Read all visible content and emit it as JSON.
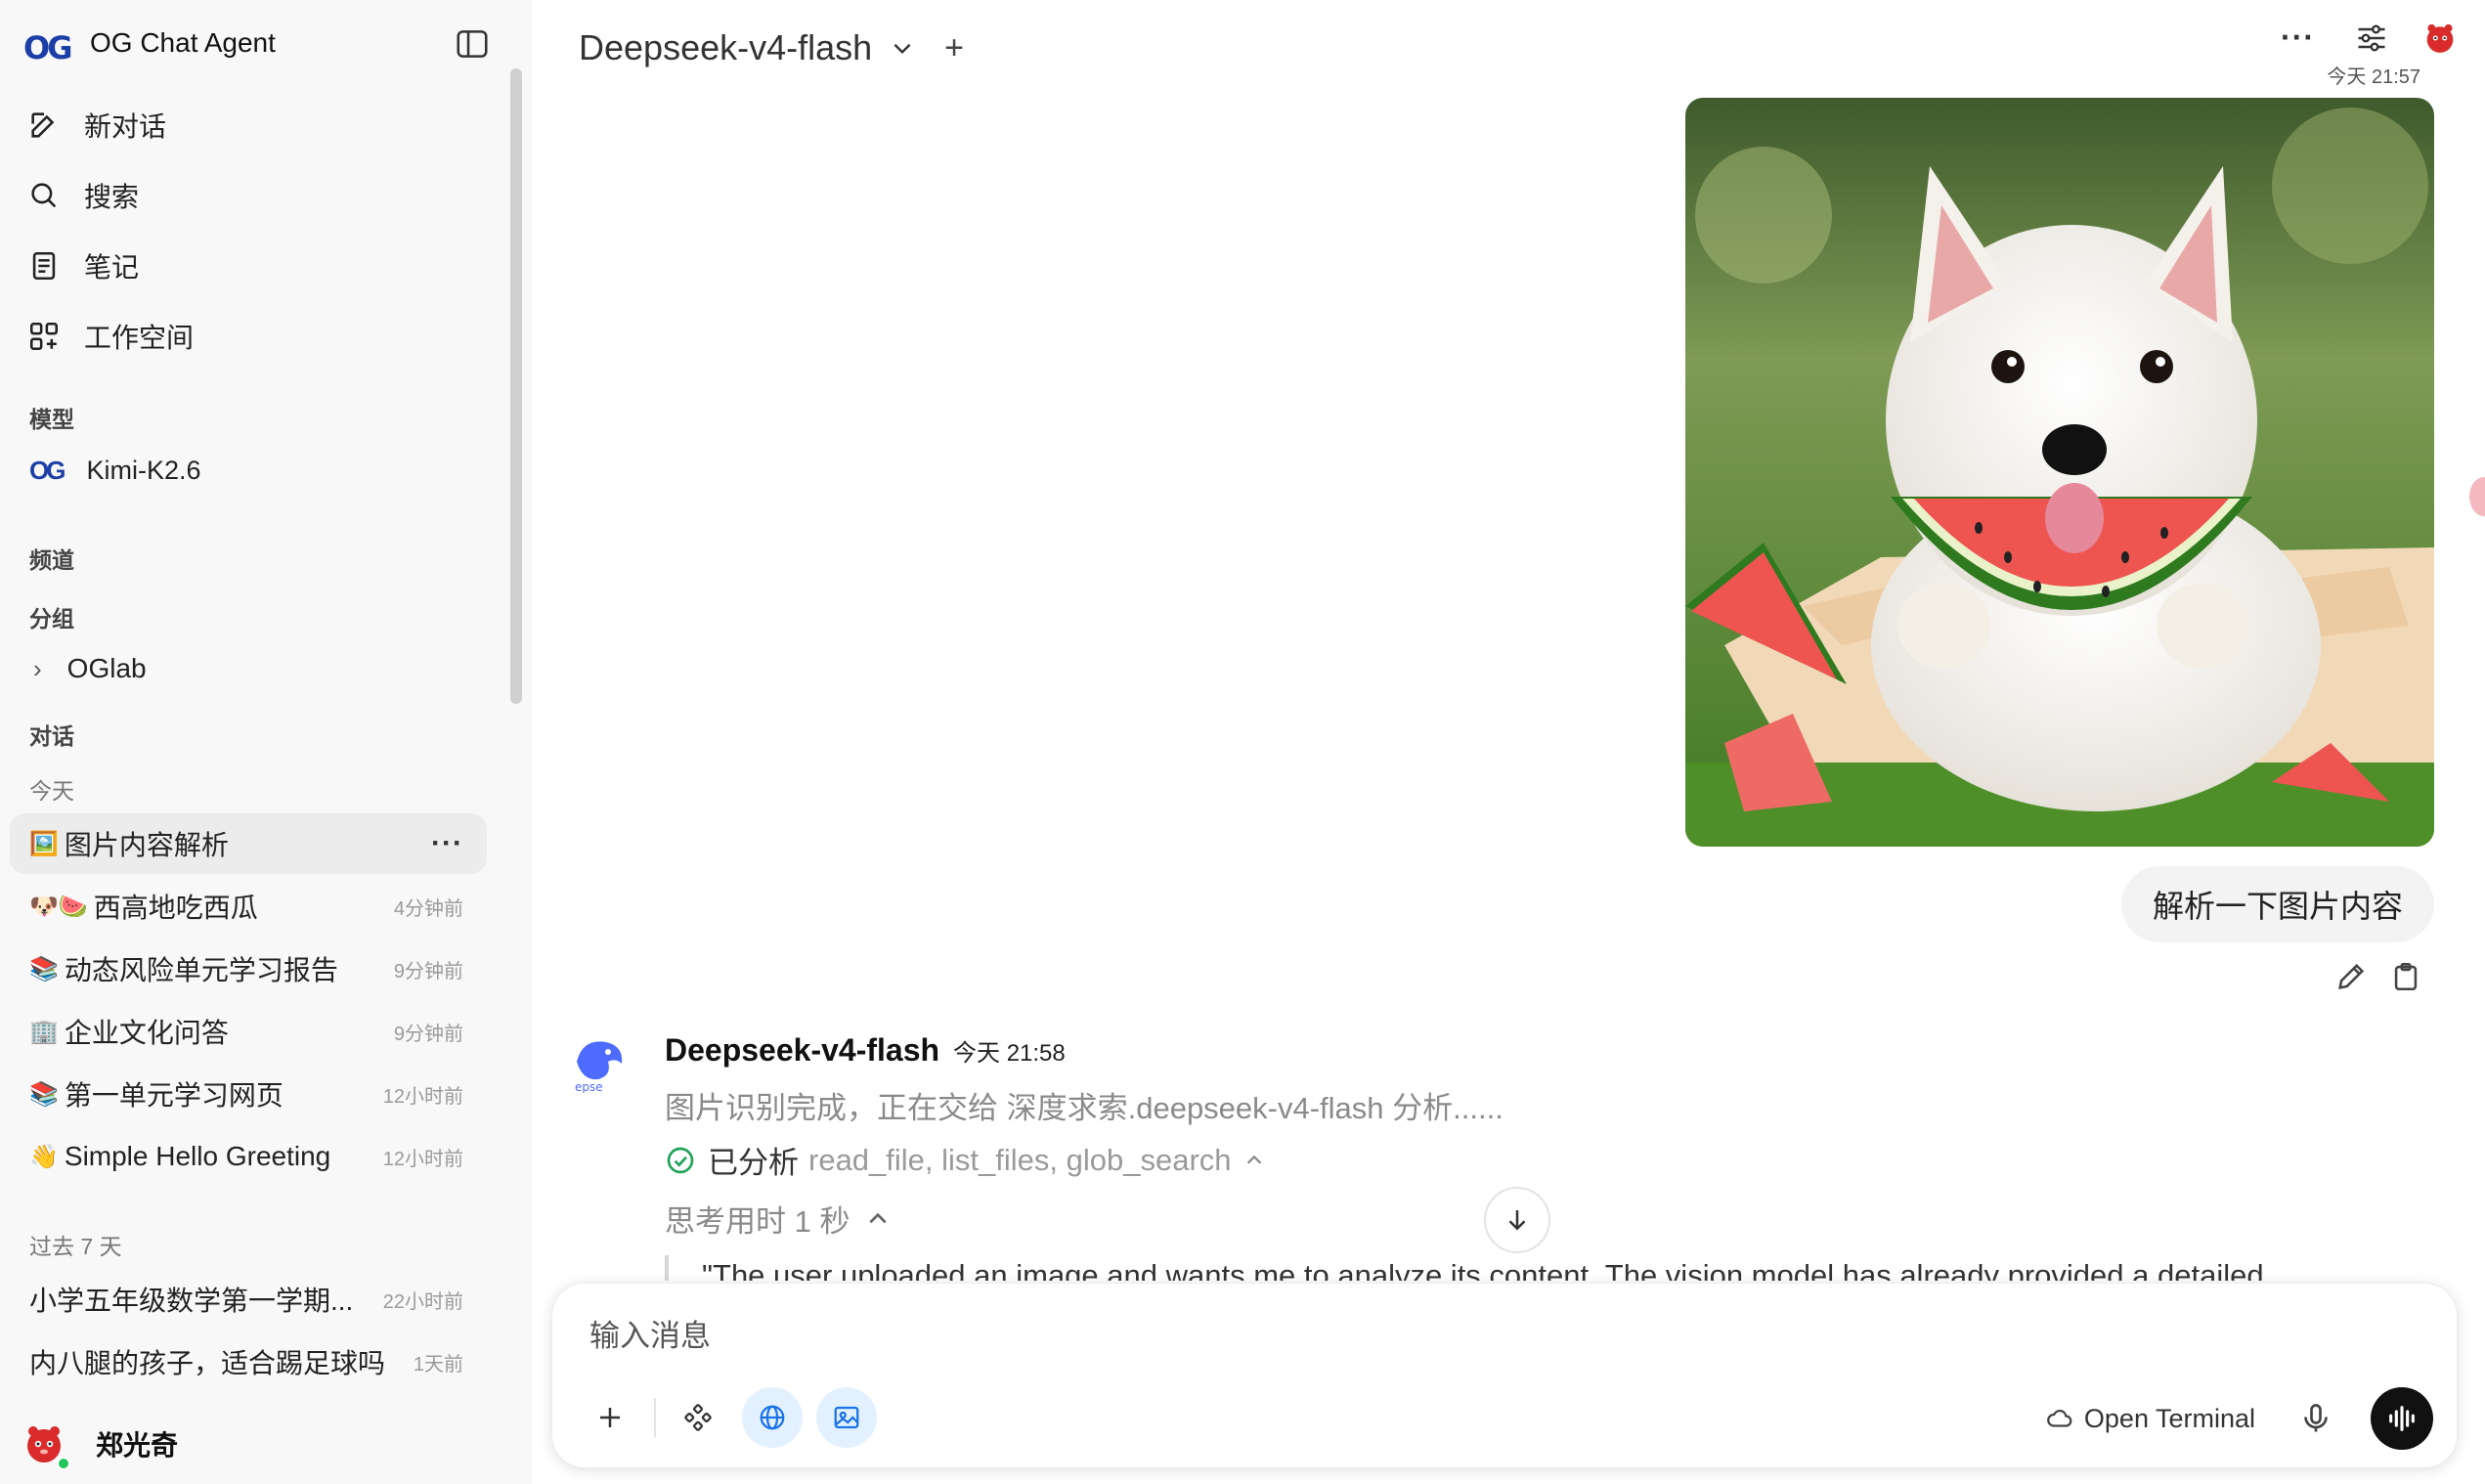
{
  "app": {
    "title": "OG Chat Agent",
    "logo_text": "OG"
  },
  "nav": {
    "new_chat": "新对话",
    "search": "搜索",
    "notes": "笔记",
    "workspace": "工作空间"
  },
  "sections": {
    "models": "模型",
    "channels": "频道",
    "groups": "分组",
    "chats": "对话",
    "today": "今天",
    "last7": "过去 7 天"
  },
  "models": [
    {
      "logo": "OG",
      "name": "Kimi-K2.6"
    }
  ],
  "groups": [
    {
      "name": "OGlab"
    }
  ],
  "conversations_today": [
    {
      "emoji": "🖼️",
      "title": "图片内容解析",
      "time": "",
      "active": true
    },
    {
      "emoji": "🐶🍉",
      "title": "西高地吃西瓜",
      "time": "4分钟前"
    },
    {
      "emoji": "📚",
      "title": "动态风险单元学习报告",
      "time": "9分钟前"
    },
    {
      "emoji": "🏢",
      "title": "企业文化问答",
      "time": "9分钟前"
    },
    {
      "emoji": "📚",
      "title": "第一单元学习网页",
      "time": "12小时前"
    },
    {
      "emoji": "👋",
      "title": "Simple Hello Greeting",
      "time": "12小时前"
    }
  ],
  "conversations_last7": [
    {
      "title": "小学五年级数学第一学期...",
      "time": "22小时前"
    },
    {
      "title": "内八腿的孩子，适合踢足球吗",
      "time": "1天前"
    }
  ],
  "user": {
    "name": "郑光奇"
  },
  "header": {
    "model_name": "Deepseek-v4-flash",
    "add_label": "+",
    "more_label": "···"
  },
  "user_message": {
    "time": "今天 21:57",
    "text": "解析一下图片内容",
    "image_alt": "west highland terrier eating watermelon"
  },
  "assistant_message": {
    "name": "Deepseek-v4-flash",
    "time": "今天 21:58",
    "status": "图片识别完成，正在交给 深度求索.deepseek-v4-flash 分析......",
    "tools_done_label": "已分析",
    "tools_list": "read_file, list_files, glob_search",
    "thinking_label": "思考用时 1 秒",
    "thought_text": "\"The user uploaded an image and wants me to analyze its content. The vision model has already provided a detailed"
  },
  "composer": {
    "placeholder": "输入消息",
    "open_terminal": "Open Terminal"
  },
  "colors": {
    "brand": "#1c3fa7",
    "accent_active_tool": "#e3f0ff",
    "success": "#22c55e"
  }
}
